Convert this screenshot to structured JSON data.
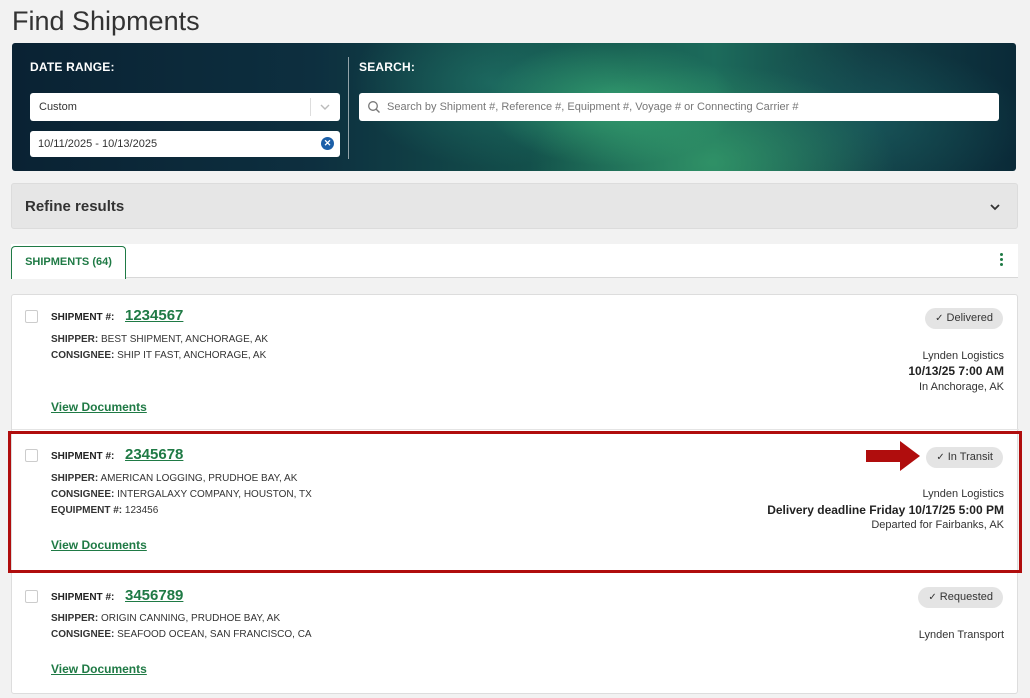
{
  "page": {
    "title": "Find Shipments"
  },
  "filters": {
    "date_range_label": "DATE RANGE:",
    "date_range_selected": "Custom",
    "date_value": "10/11/2025 - 10/13/2025",
    "search_label": "SEARCH:",
    "search_placeholder": "Search by Shipment #, Reference #, Equipment #, Voyage # or Connecting Carrier #"
  },
  "refine": {
    "label": "Refine results"
  },
  "tabs": {
    "shipments_label": "SHIPMENTS (64)"
  },
  "shipments": [
    {
      "shipment_label": "SHIPMENT #:",
      "number": "1234567",
      "shipper_label": "SHIPPER:",
      "shipper": "BEST SHIPMENT, ANCHORAGE, AK",
      "consignee_label": "CONSIGNEE:",
      "consignee": "SHIP IT FAST, ANCHORAGE, AK",
      "status": "Delivered",
      "carrier": "Lynden Logistics",
      "datetime": "10/13/25 7:00 AM",
      "location": "In Anchorage, AK",
      "view_docs": "View Documents"
    },
    {
      "shipment_label": "SHIPMENT #:",
      "number": "2345678",
      "shipper_label": "SHIPPER:",
      "shipper": "AMERICAN LOGGING, PRUDHOE BAY, AK",
      "consignee_label": "CONSIGNEE:",
      "consignee": "INTERGALAXY COMPANY, HOUSTON, TX",
      "equipment_label": "EQUIPMENT #:",
      "equipment": "123456",
      "status": "In Transit",
      "carrier": "Lynden Logistics",
      "datetime": "Delivery deadline Friday 10/17/25 5:00 PM",
      "location": "Departed for Fairbanks, AK",
      "view_docs": "View Documents"
    },
    {
      "shipment_label": "SHIPMENT #:",
      "number": "3456789",
      "shipper_label": "SHIPPER:",
      "shipper": "ORIGIN CANNING, PRUDHOE BAY, AK",
      "consignee_label": "CONSIGNEE:",
      "consignee": "SEAFOOD OCEAN, SAN FRANCISCO, CA",
      "status": "Requested",
      "carrier": "Lynden Transport",
      "view_docs": "View Documents"
    }
  ],
  "colors": {
    "accent": "#1f7a45",
    "highlight": "#b00d0d",
    "clear": "#1b5fa8"
  },
  "icons": {
    "chevron": "chevron-down-icon",
    "search": "search-icon",
    "clear": "close-circle-icon",
    "menu": "kebab-menu-icon",
    "check": "check-icon",
    "arrow": "arrow-right-icon"
  }
}
